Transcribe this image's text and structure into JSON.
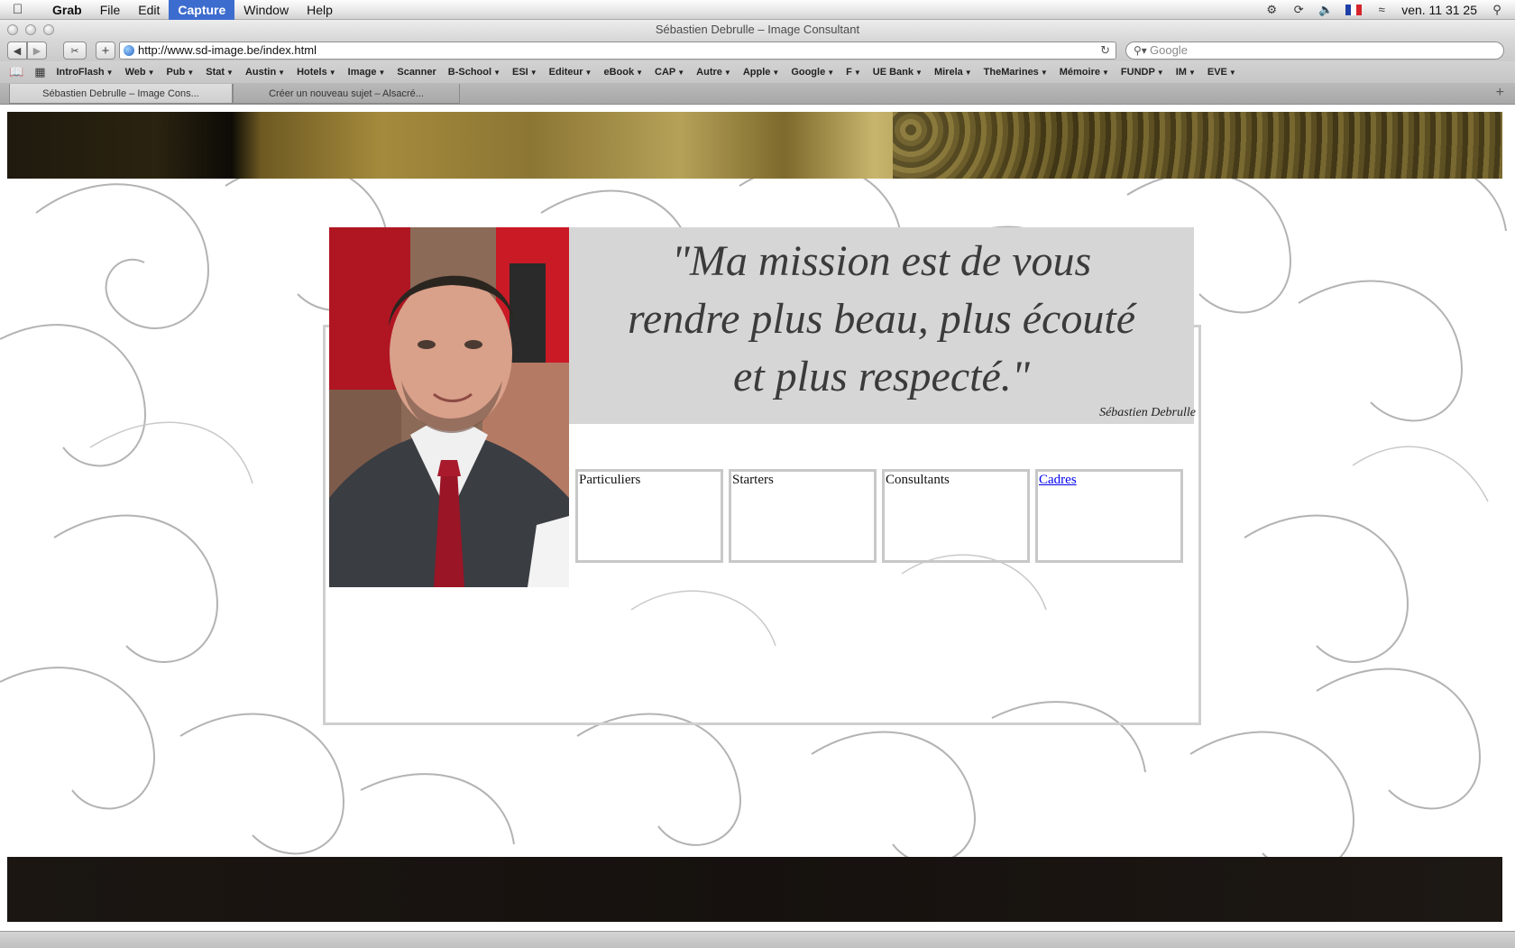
{
  "menubar": {
    "app": "Grab",
    "items": [
      "File",
      "Edit",
      "Capture",
      "Window",
      "Help"
    ],
    "active_item": "Capture",
    "clock": "ven. 11 31 25"
  },
  "window": {
    "title": "Sébastien Debrulle – Image Consultant"
  },
  "toolbar": {
    "url": "http://www.sd-image.be/index.html",
    "search_placeholder": "Google"
  },
  "bookmarks": [
    "IntroFlash",
    "Web",
    "Pub",
    "Stat",
    "Austin",
    "Hotels",
    "Image",
    "Scanner",
    "B-School",
    "ESI",
    "Editeur",
    "eBook",
    "CAP",
    "Autre",
    "Apple",
    "Google",
    "F",
    "UE Bank",
    "Mirela",
    "TheMarines",
    "Mémoire",
    "FUNDP",
    "IM",
    "EVE"
  ],
  "bookmarks_no_caret": [
    "Scanner"
  ],
  "tabs": [
    {
      "label": "Sébastien Debrulle – Image Cons...",
      "active": true
    },
    {
      "label": "Créer un nouveau sujet – Alsacré...",
      "active": false
    }
  ],
  "page": {
    "quote": "\"Ma mission est de vous rendre plus beau, plus écouté et plus respecté.\"",
    "quote_lines": [
      "\"Ma mission est de vous",
      "rendre plus beau, plus écouté",
      "et plus respecté.\""
    ],
    "author": "Sébastien Debrulle",
    "categories": [
      {
        "label": "Particuliers",
        "link": false
      },
      {
        "label": "Starters",
        "link": false
      },
      {
        "label": "Consultants",
        "link": false
      },
      {
        "label": "Cadres",
        "link": true
      }
    ]
  },
  "colors": {
    "quote_bg": "#d6d6d6",
    "link": "#0000ee",
    "menu_active": "#3d6ccf"
  }
}
